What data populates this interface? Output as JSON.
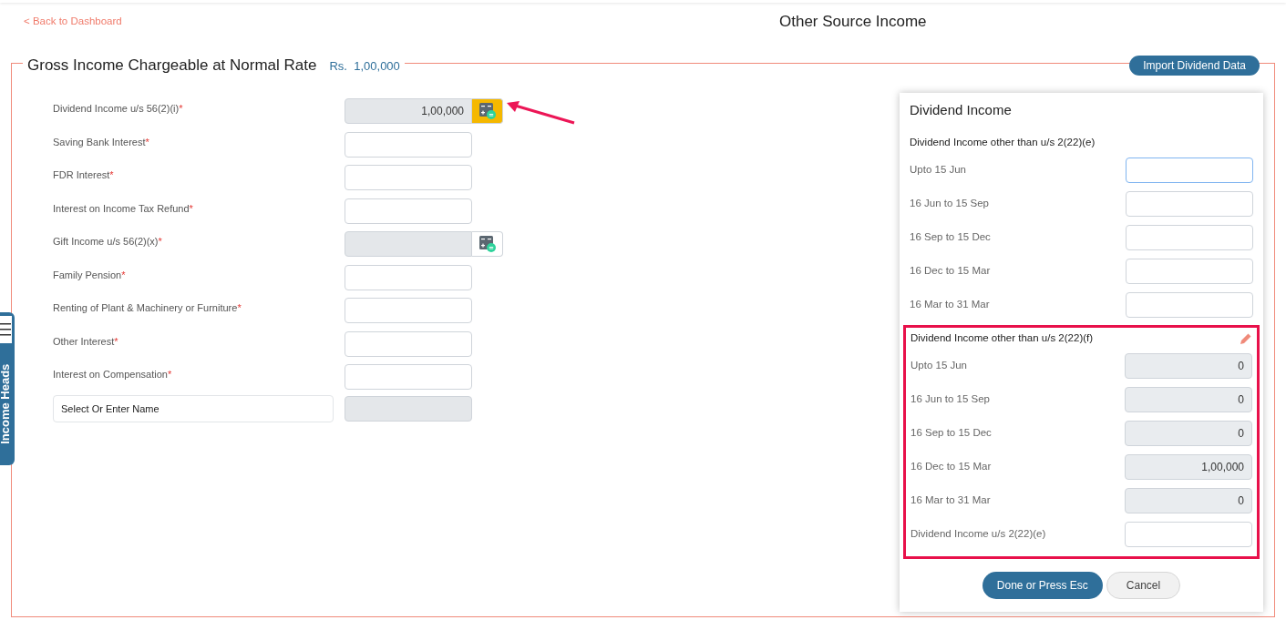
{
  "back_link": "< Back to Dashboard",
  "page_title": "Other Source Income",
  "side_tab": {
    "label": "Income Heads"
  },
  "section": {
    "title": "Gross Income Chargeable at Normal Rate",
    "currency": "Rs.",
    "total": "1,00,000",
    "import_button": "Import Dividend Data"
  },
  "fields": [
    {
      "kind": "calc",
      "label": "Dividend Income u/s 56(2)(i)",
      "required_mark": "*",
      "value": "1,00,000",
      "disabled": true,
      "highlighted": true
    },
    {
      "kind": "input",
      "label": "Saving Bank Interest",
      "required_mark": "*",
      "disabled": false
    },
    {
      "kind": "input",
      "label": "FDR Interest",
      "required_mark": "*",
      "disabled": false
    },
    {
      "kind": "input",
      "label": "Interest on Income Tax Refund",
      "required_mark": "*",
      "disabled": false
    },
    {
      "kind": "calc",
      "label": "Gift Income u/s 56(2)(x)",
      "required_mark": "*",
      "disabled": true,
      "highlighted": false
    },
    {
      "kind": "input",
      "label": "Family Pension",
      "required_mark": "*",
      "disabled": false
    },
    {
      "kind": "input",
      "label": "Renting of Plant & Machinery or Furniture",
      "required_mark": "*",
      "disabled": false
    },
    {
      "kind": "input",
      "label": "Other Interest",
      "required_mark": "*",
      "disabled": false
    },
    {
      "kind": "input",
      "label": "Interest on Compensation",
      "required_mark": "*",
      "disabled": false
    },
    {
      "kind": "name-select",
      "placeholder": "Select Or Enter Name",
      "disabled": true
    }
  ],
  "dialog": {
    "title": "Dividend Income",
    "groups": [
      {
        "heading": "Dividend Income other than u/s 2(22)(e)",
        "highlighted": false,
        "editable": false,
        "rows": [
          {
            "label": "Upto 15 Jun",
            "disabled": false,
            "focused": true
          },
          {
            "label": "16 Jun to 15 Sep",
            "disabled": false,
            "focused": false
          },
          {
            "label": "16 Sep to 15 Dec",
            "disabled": false,
            "focused": false
          },
          {
            "label": "16 Dec to 15 Mar",
            "disabled": false,
            "focused": false
          },
          {
            "label": "16 Mar to 31 Mar",
            "disabled": false,
            "focused": false
          }
        ]
      },
      {
        "heading": "Dividend Income other than u/s 2(22)(f)",
        "highlighted": true,
        "editable": true,
        "rows": [
          {
            "label": "Upto 15 Jun",
            "value": "0",
            "disabled": true,
            "focused": false
          },
          {
            "label": "16 Jun to 15 Sep",
            "value": "0",
            "disabled": true,
            "focused": false
          },
          {
            "label": "16 Sep to 15 Dec",
            "value": "0",
            "disabled": true,
            "focused": false
          },
          {
            "label": "16 Dec to 15 Mar",
            "value": "1,00,000",
            "disabled": true,
            "focused": false
          },
          {
            "label": "16 Mar to 31 Mar",
            "value": "0",
            "disabled": true,
            "focused": false
          },
          {
            "label": "Dividend Income u/s 2(22)(e)",
            "disabled": false,
            "focused": false
          }
        ]
      }
    ],
    "buttons": [
      {
        "label": "Done or Press Esc",
        "kind": "primary"
      },
      {
        "label": "Cancel",
        "kind": "secondary"
      }
    ]
  }
}
